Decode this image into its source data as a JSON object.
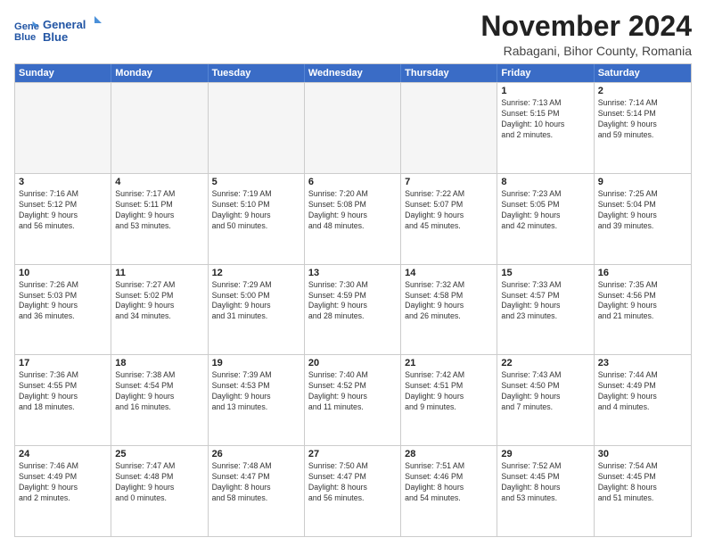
{
  "logo": {
    "line1": "General",
    "line2": "Blue"
  },
  "title": "November 2024",
  "location": "Rabagani, Bihor County, Romania",
  "headers": [
    "Sunday",
    "Monday",
    "Tuesday",
    "Wednesday",
    "Thursday",
    "Friday",
    "Saturday"
  ],
  "rows": [
    [
      {
        "day": "",
        "text": "",
        "empty": true
      },
      {
        "day": "",
        "text": "",
        "empty": true
      },
      {
        "day": "",
        "text": "",
        "empty": true
      },
      {
        "day": "",
        "text": "",
        "empty": true
      },
      {
        "day": "",
        "text": "",
        "empty": true
      },
      {
        "day": "1",
        "text": "Sunrise: 7:13 AM\nSunset: 5:15 PM\nDaylight: 10 hours\nand 2 minutes.",
        "empty": false
      },
      {
        "day": "2",
        "text": "Sunrise: 7:14 AM\nSunset: 5:14 PM\nDaylight: 9 hours\nand 59 minutes.",
        "empty": false
      }
    ],
    [
      {
        "day": "3",
        "text": "Sunrise: 7:16 AM\nSunset: 5:12 PM\nDaylight: 9 hours\nand 56 minutes.",
        "empty": false
      },
      {
        "day": "4",
        "text": "Sunrise: 7:17 AM\nSunset: 5:11 PM\nDaylight: 9 hours\nand 53 minutes.",
        "empty": false
      },
      {
        "day": "5",
        "text": "Sunrise: 7:19 AM\nSunset: 5:10 PM\nDaylight: 9 hours\nand 50 minutes.",
        "empty": false
      },
      {
        "day": "6",
        "text": "Sunrise: 7:20 AM\nSunset: 5:08 PM\nDaylight: 9 hours\nand 48 minutes.",
        "empty": false
      },
      {
        "day": "7",
        "text": "Sunrise: 7:22 AM\nSunset: 5:07 PM\nDaylight: 9 hours\nand 45 minutes.",
        "empty": false
      },
      {
        "day": "8",
        "text": "Sunrise: 7:23 AM\nSunset: 5:05 PM\nDaylight: 9 hours\nand 42 minutes.",
        "empty": false
      },
      {
        "day": "9",
        "text": "Sunrise: 7:25 AM\nSunset: 5:04 PM\nDaylight: 9 hours\nand 39 minutes.",
        "empty": false
      }
    ],
    [
      {
        "day": "10",
        "text": "Sunrise: 7:26 AM\nSunset: 5:03 PM\nDaylight: 9 hours\nand 36 minutes.",
        "empty": false
      },
      {
        "day": "11",
        "text": "Sunrise: 7:27 AM\nSunset: 5:02 PM\nDaylight: 9 hours\nand 34 minutes.",
        "empty": false
      },
      {
        "day": "12",
        "text": "Sunrise: 7:29 AM\nSunset: 5:00 PM\nDaylight: 9 hours\nand 31 minutes.",
        "empty": false
      },
      {
        "day": "13",
        "text": "Sunrise: 7:30 AM\nSunset: 4:59 PM\nDaylight: 9 hours\nand 28 minutes.",
        "empty": false
      },
      {
        "day": "14",
        "text": "Sunrise: 7:32 AM\nSunset: 4:58 PM\nDaylight: 9 hours\nand 26 minutes.",
        "empty": false
      },
      {
        "day": "15",
        "text": "Sunrise: 7:33 AM\nSunset: 4:57 PM\nDaylight: 9 hours\nand 23 minutes.",
        "empty": false
      },
      {
        "day": "16",
        "text": "Sunrise: 7:35 AM\nSunset: 4:56 PM\nDaylight: 9 hours\nand 21 minutes.",
        "empty": false
      }
    ],
    [
      {
        "day": "17",
        "text": "Sunrise: 7:36 AM\nSunset: 4:55 PM\nDaylight: 9 hours\nand 18 minutes.",
        "empty": false
      },
      {
        "day": "18",
        "text": "Sunrise: 7:38 AM\nSunset: 4:54 PM\nDaylight: 9 hours\nand 16 minutes.",
        "empty": false
      },
      {
        "day": "19",
        "text": "Sunrise: 7:39 AM\nSunset: 4:53 PM\nDaylight: 9 hours\nand 13 minutes.",
        "empty": false
      },
      {
        "day": "20",
        "text": "Sunrise: 7:40 AM\nSunset: 4:52 PM\nDaylight: 9 hours\nand 11 minutes.",
        "empty": false
      },
      {
        "day": "21",
        "text": "Sunrise: 7:42 AM\nSunset: 4:51 PM\nDaylight: 9 hours\nand 9 minutes.",
        "empty": false
      },
      {
        "day": "22",
        "text": "Sunrise: 7:43 AM\nSunset: 4:50 PM\nDaylight: 9 hours\nand 7 minutes.",
        "empty": false
      },
      {
        "day": "23",
        "text": "Sunrise: 7:44 AM\nSunset: 4:49 PM\nDaylight: 9 hours\nand 4 minutes.",
        "empty": false
      }
    ],
    [
      {
        "day": "24",
        "text": "Sunrise: 7:46 AM\nSunset: 4:49 PM\nDaylight: 9 hours\nand 2 minutes.",
        "empty": false
      },
      {
        "day": "25",
        "text": "Sunrise: 7:47 AM\nSunset: 4:48 PM\nDaylight: 9 hours\nand 0 minutes.",
        "empty": false
      },
      {
        "day": "26",
        "text": "Sunrise: 7:48 AM\nSunset: 4:47 PM\nDaylight: 8 hours\nand 58 minutes.",
        "empty": false
      },
      {
        "day": "27",
        "text": "Sunrise: 7:50 AM\nSunset: 4:47 PM\nDaylight: 8 hours\nand 56 minutes.",
        "empty": false
      },
      {
        "day": "28",
        "text": "Sunrise: 7:51 AM\nSunset: 4:46 PM\nDaylight: 8 hours\nand 54 minutes.",
        "empty": false
      },
      {
        "day": "29",
        "text": "Sunrise: 7:52 AM\nSunset: 4:45 PM\nDaylight: 8 hours\nand 53 minutes.",
        "empty": false
      },
      {
        "day": "30",
        "text": "Sunrise: 7:54 AM\nSunset: 4:45 PM\nDaylight: 8 hours\nand 51 minutes.",
        "empty": false
      }
    ]
  ]
}
